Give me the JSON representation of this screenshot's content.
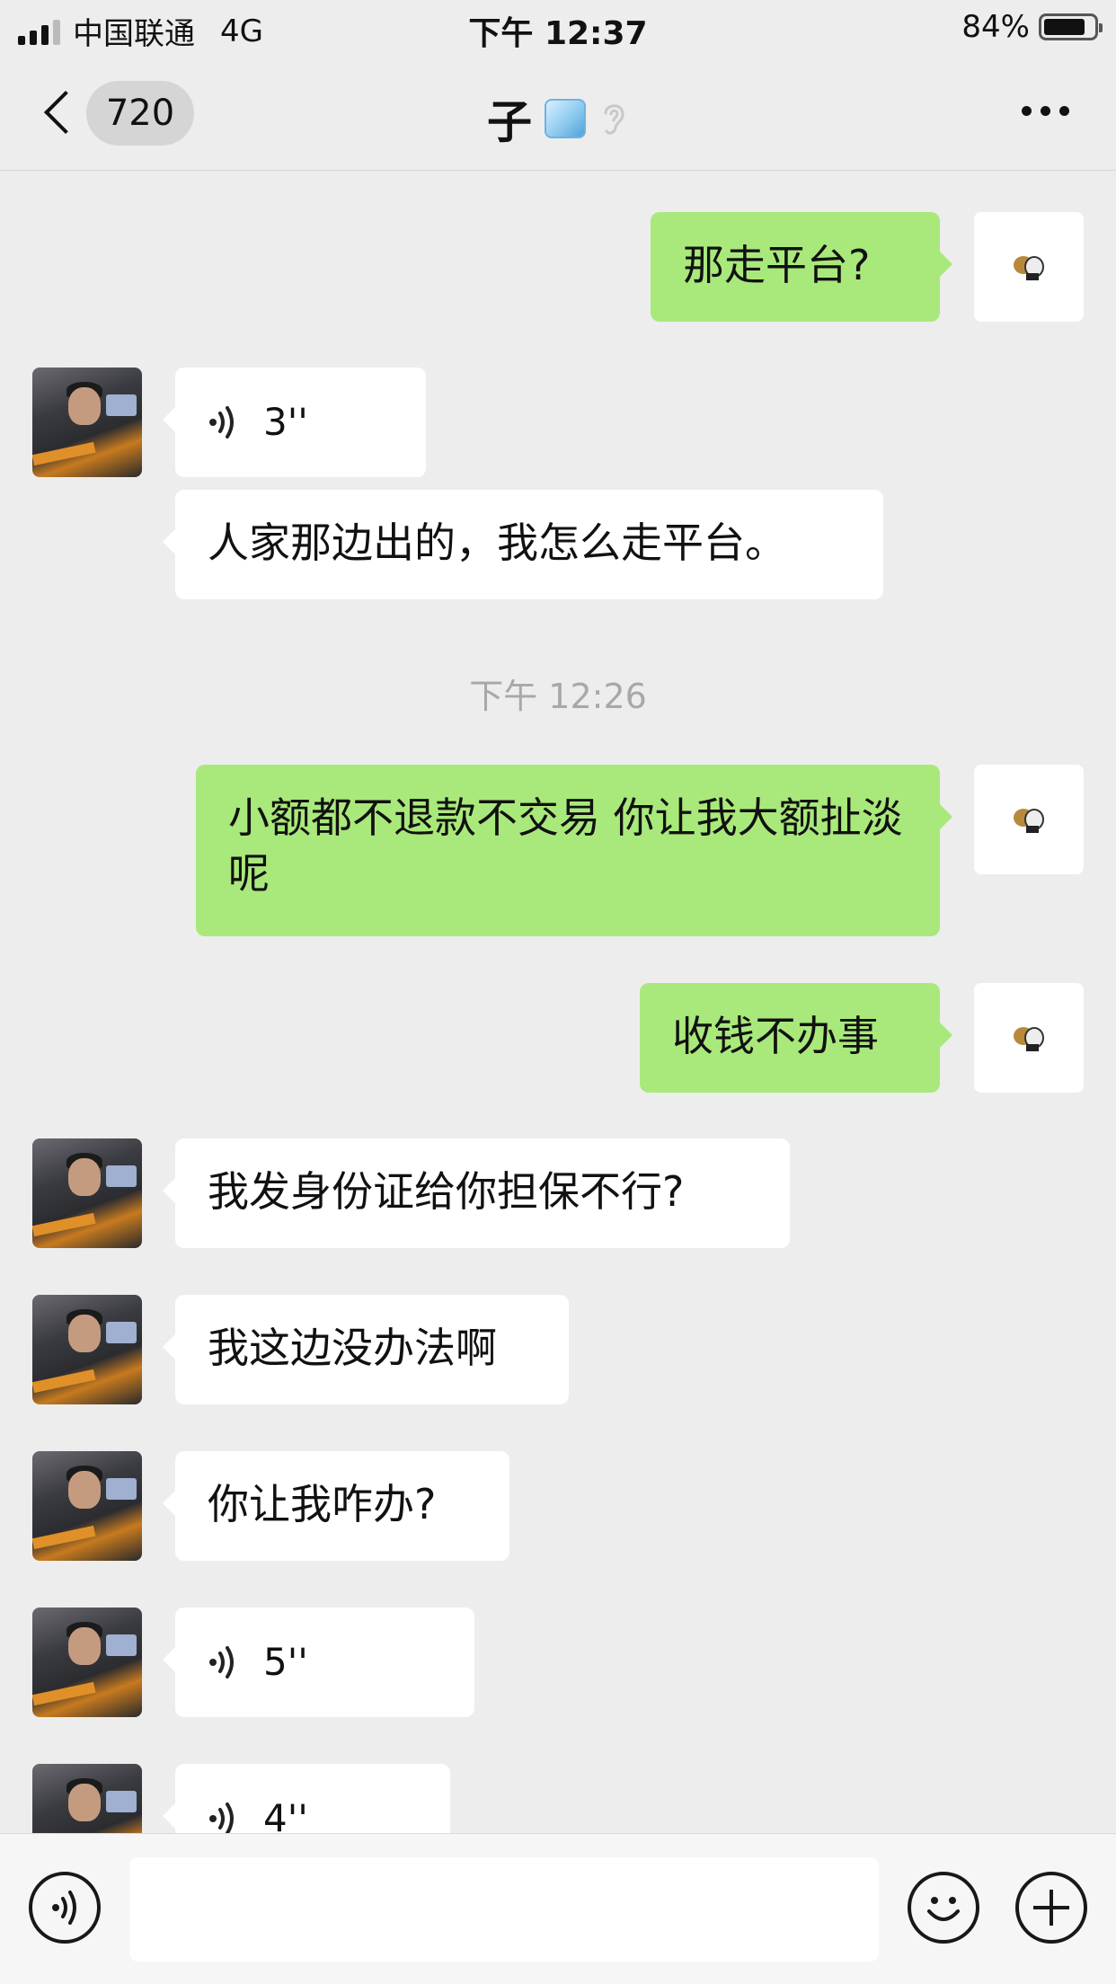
{
  "status_bar": {
    "carrier": "中国联通",
    "network": "4G",
    "time": "下午 12:37",
    "battery": "84%",
    "battery_level": 0.84
  },
  "nav": {
    "back_count": "720",
    "title": "子",
    "title_icons": [
      "ice-cube-icon",
      "ear-icon"
    ],
    "more_icon": "more-dots-icon"
  },
  "messages": [
    {
      "from": "self",
      "type": "text",
      "text": "那走平台?"
    },
    {
      "from": "other",
      "type": "voice",
      "duration": "3''"
    },
    {
      "from": "other",
      "type": "text",
      "text": "人家那边出的，我怎么走平台。"
    },
    {
      "from": "system",
      "type": "timestamp",
      "text": "下午 12:26"
    },
    {
      "from": "self",
      "type": "text",
      "text": "小额都不退款不交易 你让我大额扯淡呢"
    },
    {
      "from": "self",
      "type": "text",
      "text": "收钱不办事"
    },
    {
      "from": "other",
      "type": "text",
      "text": "我发身份证给你担保不行?"
    },
    {
      "from": "other",
      "type": "text",
      "text": "我这边没办法啊"
    },
    {
      "from": "other",
      "type": "text",
      "text": "你让我咋办?"
    },
    {
      "from": "other",
      "type": "voice",
      "duration": "5''"
    },
    {
      "from": "other",
      "type": "voice",
      "duration": "4''"
    }
  ],
  "input_bar": {
    "voice_icon": "voice-mode-icon",
    "text_value": "",
    "emoji_icon": "emoji-icon",
    "plus_icon": "plus-icon"
  }
}
